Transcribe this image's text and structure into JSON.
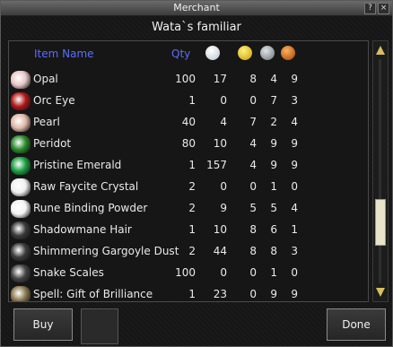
{
  "window": {
    "title": "Merchant",
    "help_glyph": "?",
    "close_glyph": "×"
  },
  "merchant_name": "Wata`s familiar",
  "columns": {
    "name": "Item Name",
    "qty": "Qty",
    "stat_icons": [
      "platinum-coin-icon",
      "gold-coin-icon",
      "silver-coin-icon",
      "copper-coin-icon"
    ]
  },
  "items": [
    {
      "name": "Opal",
      "qty": "100",
      "v1": "17",
      "v2": "8",
      "v3": "4",
      "v4": "9",
      "icon": "opal-icon",
      "color": "#e8c8c8"
    },
    {
      "name": "Orc Eye",
      "qty": "1",
      "v1": "0",
      "v2": "0",
      "v3": "7",
      "v4": "3",
      "icon": "eye-icon",
      "color": "#b01818"
    },
    {
      "name": "Pearl",
      "qty": "40",
      "v1": "4",
      "v2": "7",
      "v3": "2",
      "v4": "4",
      "icon": "pearl-icon",
      "color": "#e0b8a8"
    },
    {
      "name": "Peridot",
      "qty": "80",
      "v1": "10",
      "v2": "4",
      "v3": "9",
      "v4": "9",
      "icon": "peridot-icon",
      "color": "#2a8a2a"
    },
    {
      "name": "Pristine Emerald",
      "qty": "1",
      "v1": "157",
      "v2": "4",
      "v3": "9",
      "v4": "9",
      "icon": "emerald-icon",
      "color": "#1aa040"
    },
    {
      "name": "Raw Faycite Crystal",
      "qty": "2",
      "v1": "0",
      "v2": "0",
      "v3": "1",
      "v4": "0",
      "icon": "crystal-icon",
      "color": "#f0f0f0"
    },
    {
      "name": "Rune Binding Powder",
      "qty": "2",
      "v1": "9",
      "v2": "5",
      "v3": "5",
      "v4": "4",
      "icon": "powder-icon",
      "color": "#f4f4f4"
    },
    {
      "name": "Shadowmane Hair",
      "qty": "1",
      "v1": "10",
      "v2": "8",
      "v3": "6",
      "v4": "1",
      "icon": "hair-icon",
      "color": "#3a3a3a"
    },
    {
      "name": "Shimmering Gargoyle Dust",
      "qty": "2",
      "v1": "44",
      "v2": "8",
      "v3": "8",
      "v4": "3",
      "icon": "dust-icon",
      "color": "#3c3c3c"
    },
    {
      "name": "Snake Scales",
      "qty": "100",
      "v1": "0",
      "v2": "0",
      "v3": "1",
      "v4": "0",
      "icon": "scales-icon",
      "color": "#444444"
    },
    {
      "name": "Spell: Gift of Brilliance",
      "qty": "1",
      "v1": "23",
      "v2": "0",
      "v3": "9",
      "v4": "9",
      "icon": "scroll-icon",
      "color": "#8a7a50"
    }
  ],
  "buttons": {
    "buy": "Buy",
    "done": "Done"
  },
  "colors": {
    "header_text": "#5c6cff",
    "scroll_arrow": "#d8c060",
    "platinum": "#e6ecf2",
    "gold": "#e6c21a",
    "silver": "#9aa0a8",
    "copper": "#c8641c"
  }
}
